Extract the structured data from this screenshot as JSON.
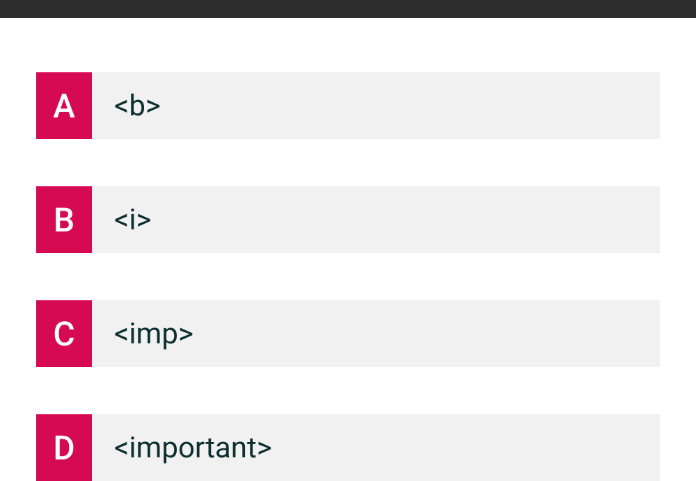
{
  "options": [
    {
      "letter": "A",
      "text": "<b>"
    },
    {
      "letter": "B",
      "text": "<i>"
    },
    {
      "letter": "C",
      "text": "<imp>"
    },
    {
      "letter": "D",
      "text": "<important>"
    }
  ]
}
